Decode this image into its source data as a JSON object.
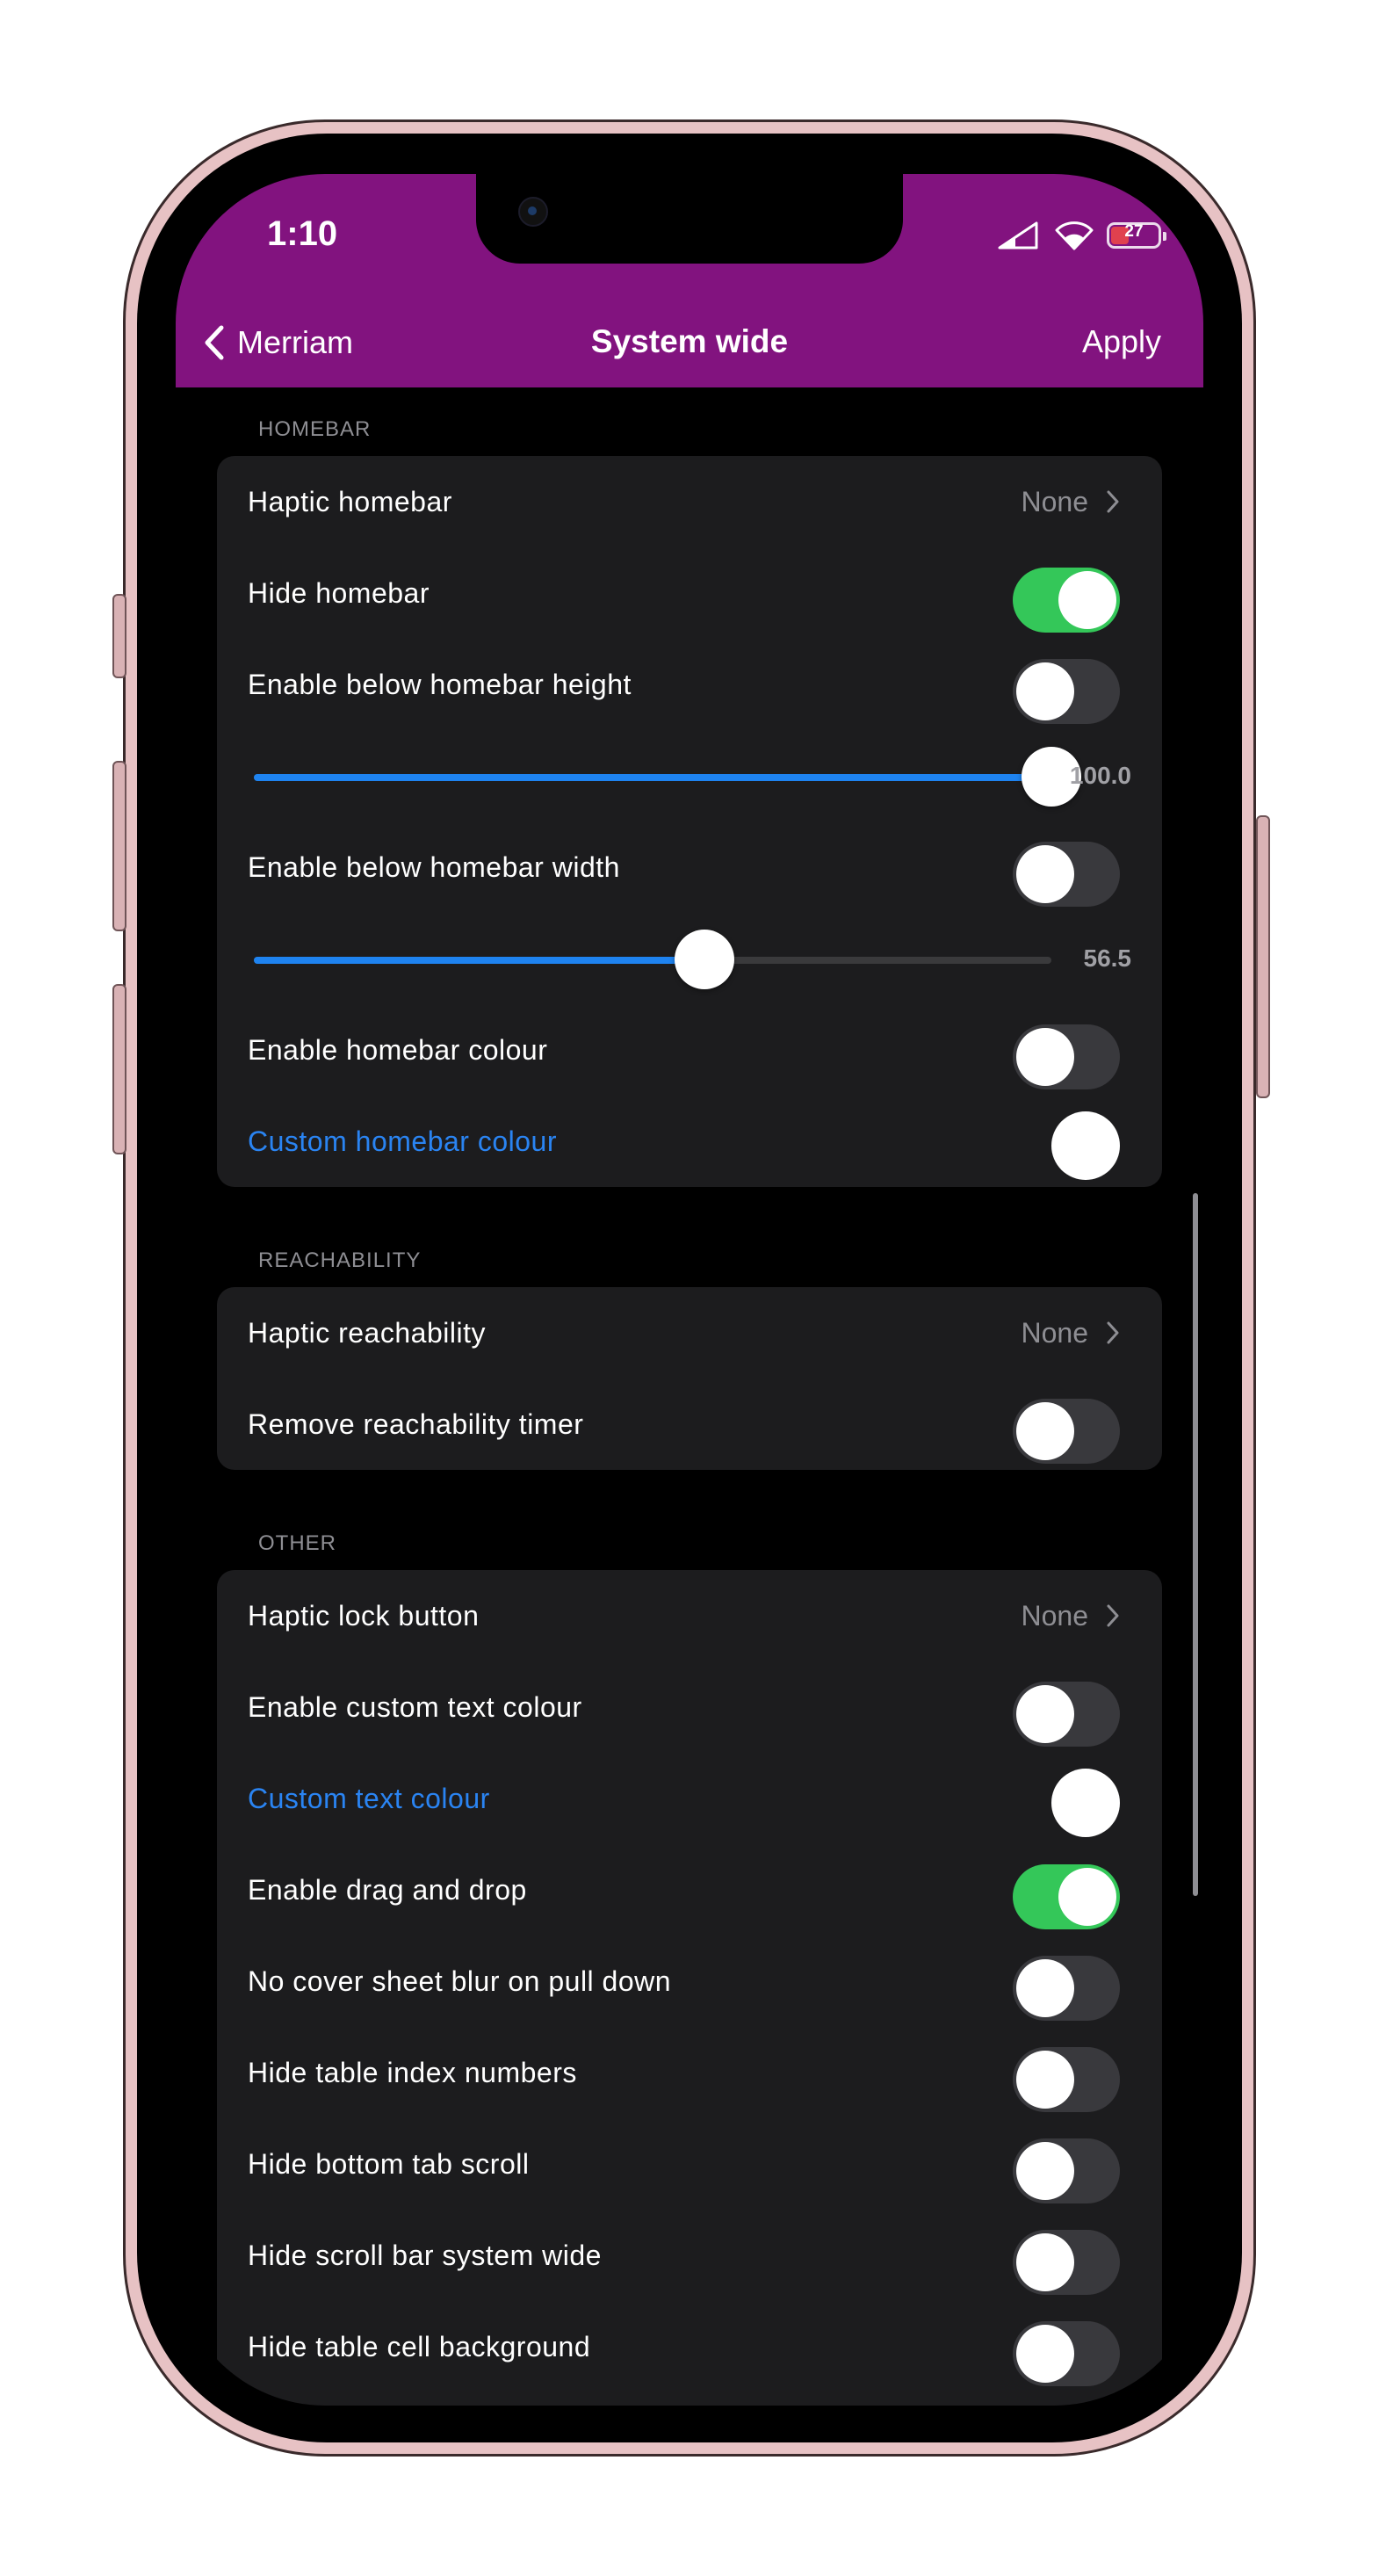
{
  "status_bar": {
    "time": "1:10",
    "battery": "27"
  },
  "nav": {
    "back_label": "Merriam",
    "title": "System wide",
    "apply_label": "Apply"
  },
  "colors": {
    "nav_bg": "#82137f",
    "accent_blue": "#2a84f2",
    "toggle_on": "#34c759",
    "toggle_off": "#39393d",
    "card_bg": "#1c1c1e"
  },
  "sections": {
    "homebar": {
      "header": "HOMEBAR",
      "haptic_homebar": {
        "label": "Haptic homebar",
        "value": "None"
      },
      "hide_homebar": {
        "label": "Hide homebar",
        "on": true
      },
      "below_height_toggle": {
        "label": "Enable below homebar height",
        "on": false
      },
      "below_height_slider": {
        "value": "100.0",
        "fraction": 1.0
      },
      "below_width_toggle": {
        "label": "Enable below homebar width",
        "on": false
      },
      "below_width_slider": {
        "value": "56.5",
        "fraction": 0.565
      },
      "homebar_colour_toggle": {
        "label": "Enable homebar colour",
        "on": false
      },
      "custom_homebar_colour": {
        "label": "Custom homebar colour",
        "color": "#ffffff"
      }
    },
    "reachability": {
      "header": "REACHABILITY",
      "haptic_reachability": {
        "label": "Haptic reachability",
        "value": "None"
      },
      "remove_timer": {
        "label": "Remove reachability timer",
        "on": false
      }
    },
    "other": {
      "header": "OTHER",
      "haptic_lock_button": {
        "label": "Haptic lock button",
        "value": "None"
      },
      "custom_text_colour_toggle": {
        "label": "Enable custom text colour",
        "on": false
      },
      "custom_text_colour": {
        "label": "Custom text colour",
        "color": "#ffffff"
      },
      "drag_and_drop": {
        "label": "Enable drag and drop",
        "on": true
      },
      "no_cover_sheet_blur": {
        "label": "No cover sheet blur on pull down",
        "on": false
      },
      "hide_table_index": {
        "label": "Hide table index numbers",
        "on": false
      },
      "hide_bottom_tab_scroll": {
        "label": "Hide bottom tab scroll",
        "on": false
      },
      "hide_scroll_bar": {
        "label": "Hide scroll bar system wide",
        "on": false
      },
      "hide_table_cell_bg": {
        "label": "Hide table cell background",
        "on": false
      }
    }
  }
}
